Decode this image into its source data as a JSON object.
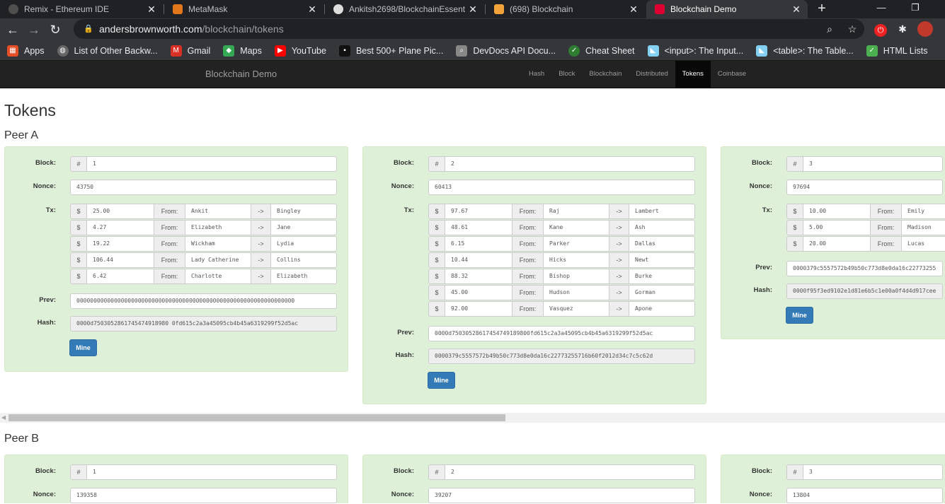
{
  "browser": {
    "tabs": [
      {
        "title": "Remix - Ethereum IDE",
        "icon": "remix-icon",
        "color": "#4f4f4f"
      },
      {
        "title": "MetaMask",
        "icon": "metamask-fox-icon",
        "color": "#e2761b"
      },
      {
        "title": "Ankitsh2698/BlockchainEssent",
        "icon": "github-icon",
        "color": "#dddddd"
      },
      {
        "title": "(698) Blockchain",
        "icon": "youtube-like-icon",
        "color": "#f2a33a"
      },
      {
        "title": "Blockchain Demo",
        "icon": "angular-icon",
        "color": "#dd0031",
        "active": true
      }
    ],
    "url_host": "andersbrownworth.com",
    "url_path": "/blockchain/tokens",
    "bookmarks": [
      {
        "label": "Apps",
        "icon": "apps-grid-icon",
        "color": "#e44d26"
      },
      {
        "label": "List of Other Backw...",
        "icon": "globe-icon",
        "color": "#666666"
      },
      {
        "label": "Gmail",
        "icon": "gmail-icon",
        "color": "#d93025"
      },
      {
        "label": "Maps",
        "icon": "maps-icon",
        "color": "#34a853"
      },
      {
        "label": "YouTube",
        "icon": "youtube-icon",
        "color": "#ff0000"
      },
      {
        "label": "Best 500+ Plane Pic...",
        "icon": "unsplash-icon",
        "color": "#111111"
      },
      {
        "label": "DevDocs API Docu...",
        "icon": "devdocs-icon",
        "color": "#888888"
      },
      {
        "label": "Cheat Sheet",
        "icon": "cheatsheet-icon",
        "color": "#2e7d32"
      },
      {
        "label": "<input>: The Input...",
        "icon": "mdn-icon",
        "color": "#83d0f2"
      },
      {
        "label": "<table>: The Table...",
        "icon": "mdn-icon",
        "color": "#83d0f2"
      },
      {
        "label": "HTML Lists",
        "icon": "w3schools-icon",
        "color": "#4caf50"
      }
    ]
  },
  "site": {
    "brand": "Blockchain Demo",
    "nav": [
      {
        "label": "Hash"
      },
      {
        "label": "Block"
      },
      {
        "label": "Blockchain"
      },
      {
        "label": "Distributed"
      },
      {
        "label": "Tokens",
        "active": true
      },
      {
        "label": "Coinbase"
      }
    ]
  },
  "page": {
    "title": "Tokens",
    "labels": {
      "block": "Block:",
      "nonce": "Nonce:",
      "tx": "Tx:",
      "prev": "Prev:",
      "hash": "Hash:",
      "mine": "Mine",
      "hash_sign": "#",
      "dollar": "$",
      "from": "From:",
      "arrow": "->"
    },
    "peers": [
      {
        "name": "Peer A",
        "blocks": [
          {
            "number": "1",
            "nonce": "43750",
            "tx": [
              {
                "amount": "25.00",
                "from": "Ankit",
                "to": "Bingley"
              },
              {
                "amount": "4.27",
                "from": "Elizabeth",
                "to": "Jane"
              },
              {
                "amount": "19.22",
                "from": "Wickham",
                "to": "Lydia"
              },
              {
                "amount": "106.44",
                "from": "Lady Catherine",
                "to": "Collins"
              },
              {
                "amount": "6.42",
                "from": "Charlotte",
                "to": "Elizabeth"
              }
            ],
            "prev": "0000000000000000000000000000000000000000000000000000000000000000",
            "hash": "0000d7503052861745474918980 0fd615c2a3a45095cb4b45a6319299f52d5ac"
          },
          {
            "number": "2",
            "nonce": "60413",
            "tx": [
              {
                "amount": "97.67",
                "from": "Raj",
                "to": "Lambert"
              },
              {
                "amount": "48.61",
                "from": "Kane",
                "to": "Ash"
              },
              {
                "amount": "6.15",
                "from": "Parker",
                "to": "Dallas"
              },
              {
                "amount": "10.44",
                "from": "Hicks",
                "to": "Newt"
              },
              {
                "amount": "88.32",
                "from": "Bishop",
                "to": "Burke"
              },
              {
                "amount": "45.00",
                "from": "Hudson",
                "to": "Gorman"
              },
              {
                "amount": "92.00",
                "from": "Vasquez",
                "to": "Apone"
              }
            ],
            "prev": "0000d75030528617454749189800fd615c2a3a45095cb4b45a6319299f52d5ac",
            "hash": "0000379c5557572b49b50c773d8e0da16c22773255716b60f2012d34c7c5c62d"
          },
          {
            "number": "3",
            "nonce": "97694",
            "tx": [
              {
                "amount": "10.00",
                "from": "Emily",
                "to": ""
              },
              {
                "amount": "5.00",
                "from": "Madison",
                "to": ""
              },
              {
                "amount": "20.00",
                "from": "Lucas",
                "to": ""
              }
            ],
            "prev": "0000379c5557572b49b50c773d8e0da16c22773255",
            "hash": "0000f95f3ed9102e1d81e6b5c1e00a0f4d4d917cee"
          }
        ]
      },
      {
        "name": "Peer B",
        "blocks": [
          {
            "number": "1",
            "nonce": "139358"
          },
          {
            "number": "2",
            "nonce": "39207"
          },
          {
            "number": "3",
            "nonce": "13804"
          }
        ]
      }
    ]
  }
}
